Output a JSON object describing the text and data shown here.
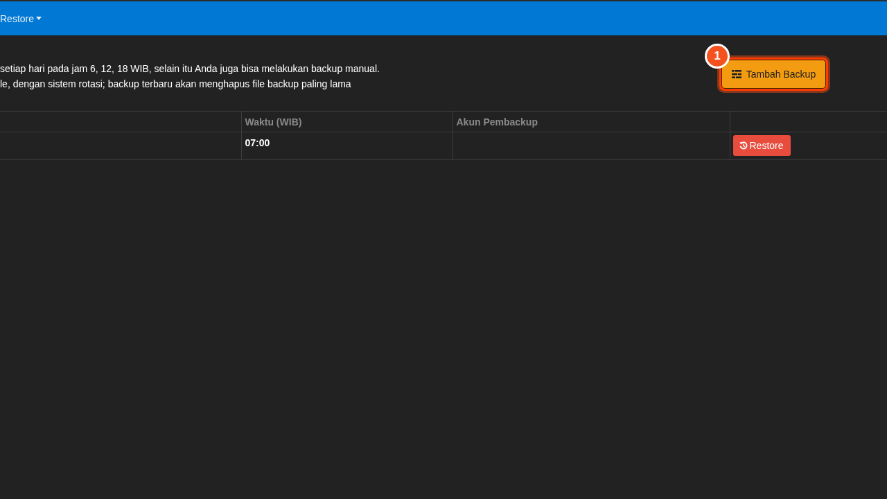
{
  "navbar": {
    "menu_item": {
      "label": "Restore",
      "dropdown": true
    }
  },
  "notice": {
    "lines": [
      "setiap hari pada jam 6, 12, 18 WIB, selain itu Anda juga bisa melakukan backup manual.",
      "le, dengan sistem rotasi; backup terbaru akan menghapus file backup paling lama"
    ]
  },
  "add_backup_button": {
    "label": "Tambah Backup",
    "highlighted": true,
    "step_badge": "1"
  },
  "table": {
    "columns": {
      "column_2": "Waktu (WIB)",
      "column_3": "Akun Pembackup"
    },
    "rows": [
      {
        "column_2": "07:00",
        "column_4": {
          "label": "Restore"
        }
      }
    ]
  }
}
